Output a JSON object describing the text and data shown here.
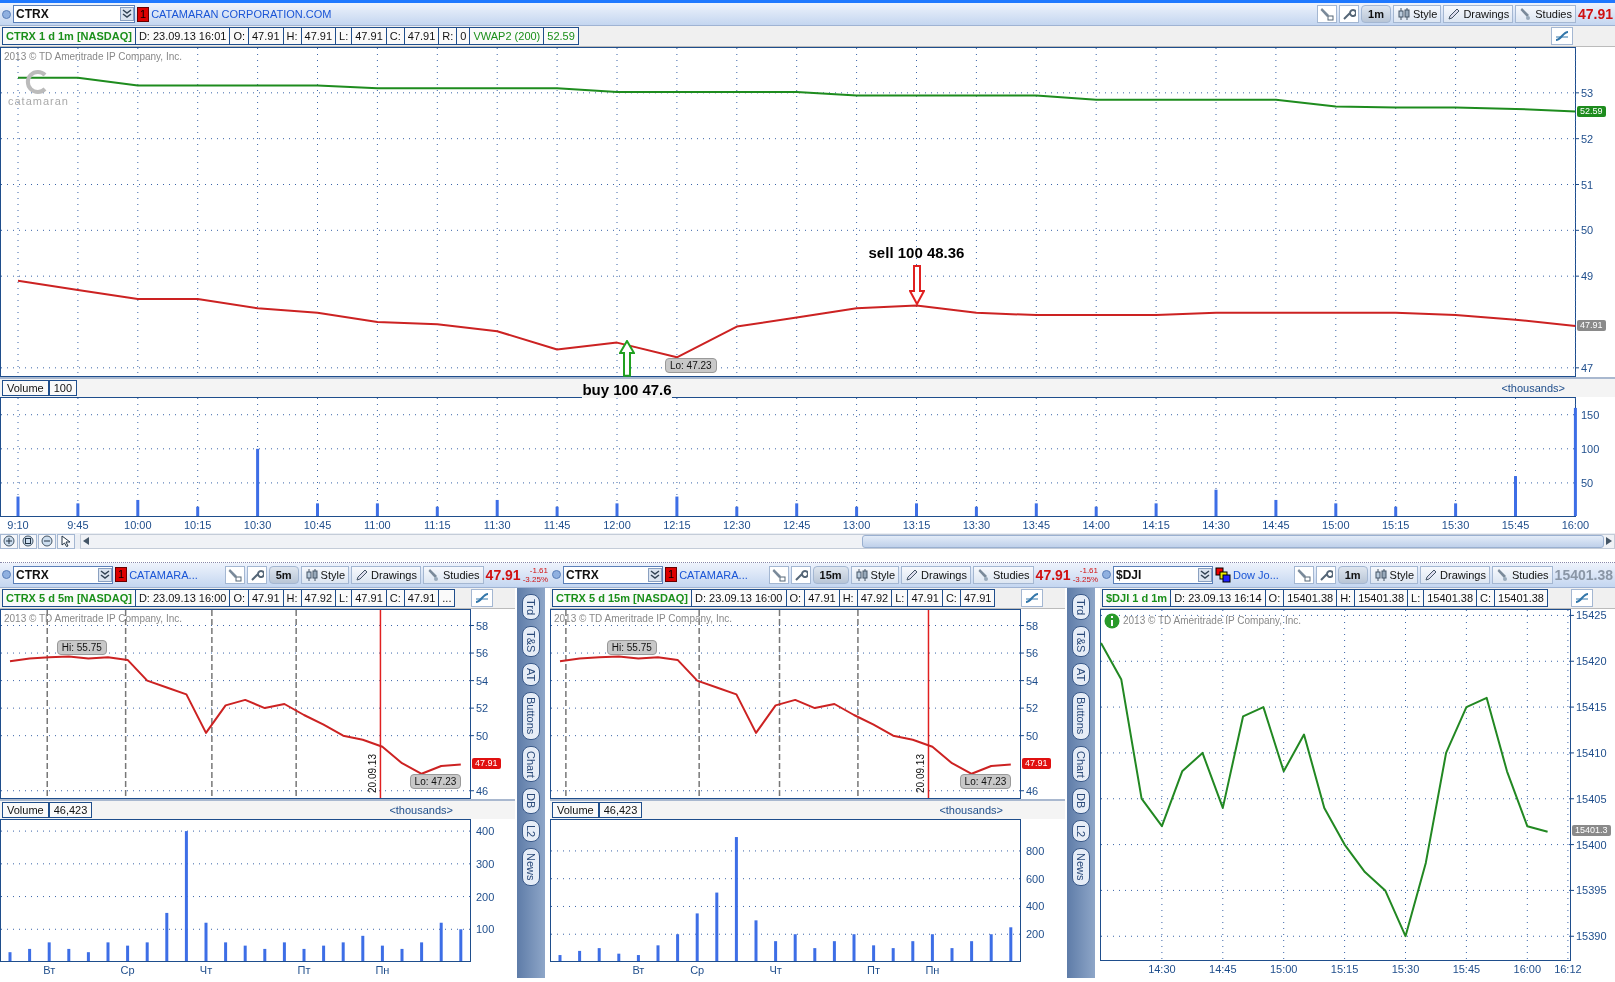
{
  "main": {
    "header": {
      "symbol": "CTRX",
      "badge": {
        "kind": "alert",
        "text": "1"
      },
      "company": "CATAMARAN CORPORATION.COM",
      "interval": "1m",
      "buttons": [
        {
          "kind": "style",
          "label": "Style"
        },
        {
          "kind": "drawings",
          "label": "Drawings"
        },
        {
          "kind": "studies",
          "label": "Studies"
        }
      ],
      "last": "47.91",
      "falling": true
    },
    "info": [
      {
        "kind": "title",
        "text": "CTRX 1 d 1m [NASDAQ]"
      },
      {
        "kind": "cell",
        "text": "D: 23.09.13 16:01"
      },
      {
        "kind": "cell",
        "text": "O:"
      },
      {
        "kind": "cell",
        "text": "47.91"
      },
      {
        "kind": "cell",
        "text": "H:"
      },
      {
        "kind": "cell",
        "text": "47.91"
      },
      {
        "kind": "cell",
        "text": "L:"
      },
      {
        "kind": "cell",
        "text": "47.91"
      },
      {
        "kind": "cell",
        "text": "C:"
      },
      {
        "kind": "cell",
        "text": "47.91"
      },
      {
        "kind": "cell",
        "text": "R:"
      },
      {
        "kind": "cell",
        "text": "0"
      },
      {
        "kind": "study",
        "text": "VWAP2 (200)"
      },
      {
        "kind": "study",
        "text": "52.59"
      }
    ],
    "watermark": "2013 © TD Ameritrade IP Company, Inc.",
    "logo": "catamaran",
    "price": {
      "chart_data": {
        "type": "line",
        "ylim": [
          46.8,
          54
        ],
        "yticks": [
          47,
          49,
          50,
          51,
          52,
          53
        ],
        "grid": true,
        "series": [
          {
            "color": "#1e8c1e",
            "values": [
              53.33,
              53.33,
              53.16,
              53.16,
              53.16,
              53.16,
              53.1,
              53.1,
              53.1,
              53.1,
              53.02,
              53.02,
              53.02,
              53.02,
              52.94,
              52.94,
              52.94,
              52.94,
              52.85,
              52.85,
              52.85,
              52.85,
              52.7,
              52.68,
              52.68,
              52.65,
              52.59
            ]
          },
          {
            "color": "#cc2222",
            "values": [
              48.9,
              48.7,
              48.5,
              48.5,
              48.3,
              48.2,
              48.0,
              47.95,
              47.8,
              47.4,
              47.55,
              47.23,
              47.9,
              48.1,
              48.3,
              48.36,
              48.2,
              48.15,
              48.15,
              48.15,
              48.2,
              48.2,
              48.2,
              48.2,
              48.15,
              48.05,
              47.91
            ]
          }
        ],
        "annotations": [
          {
            "text": "sell 100 48.36",
            "y": 48.36
          },
          {
            "text": "buy 100 47.6",
            "y": 47.6
          },
          "Lo: 47.23"
        ]
      },
      "markers": [
        {
          "kind": "sell"
        },
        {
          "kind": "buy"
        },
        {
          "kind": "low"
        }
      ],
      "tags": [
        {
          "text": "52.59",
          "color": "#1e8c1e"
        },
        {
          "text": "47.91",
          "color": "#8a8a8a"
        }
      ]
    },
    "volume": {
      "label": "Volume",
      "value": "100",
      "units": "<thousands>",
      "chart_data": {
        "type": "bar",
        "categories": [
          "9:10",
          "9:45",
          "10:00",
          "10:15",
          "10:30",
          "10:45",
          "11:00",
          "11:15",
          "11:30",
          "11:45",
          "12:00",
          "12:15",
          "12:30",
          "12:45",
          "13:00",
          "13:15",
          "13:30",
          "13:45",
          "14:00",
          "14:15",
          "14:30",
          "14:45",
          "15:00",
          "15:15",
          "15:30",
          "15:45",
          "16:00"
        ],
        "ylim": [
          0,
          176
        ],
        "yticks": [
          50,
          100,
          150
        ],
        "grid": true,
        "values": [
          30,
          20,
          25,
          15,
          100,
          20,
          20,
          15,
          25,
          15,
          20,
          30,
          15,
          20,
          15,
          20,
          15,
          20,
          15,
          20,
          40,
          25,
          20,
          15,
          20,
          60,
          160
        ]
      }
    }
  },
  "panels": [
    {
      "header": {
        "symbol": "CTRX",
        "badge": {
          "kind": "alert",
          "text": "1"
        },
        "company": "CATAMARA...",
        "interval": "5m",
        "buttons": [
          {
            "kind": "style",
            "label": "Style"
          },
          {
            "kind": "drawings",
            "label": "Drawings"
          },
          {
            "kind": "studies",
            "label": "Studies"
          }
        ],
        "last": "47.91",
        "falling": true,
        "change": [
          "-1.61",
          "-3.25%"
        ]
      },
      "info": [
        {
          "kind": "title",
          "text": "CTRX 5 d 5m [NASDAQ]"
        },
        {
          "kind": "cell",
          "text": "D: 23.09.13 16:00"
        },
        {
          "kind": "cell",
          "text": "O:"
        },
        {
          "kind": "cell",
          "text": "47.91"
        },
        {
          "kind": "cell",
          "text": "H:"
        },
        {
          "kind": "cell",
          "text": "47.92"
        },
        {
          "kind": "cell",
          "text": "L:"
        },
        {
          "kind": "cell",
          "text": "47.91"
        },
        {
          "kind": "cell",
          "text": "C:"
        },
        {
          "kind": "cell",
          "text": "47.91"
        },
        {
          "kind": "cell",
          "text": "..."
        }
      ],
      "watermark": "2013 © TD Ameritrade IP Company, Inc.",
      "price": {
        "chart_data": {
          "type": "line",
          "ylim": [
            45.4,
            59.2
          ],
          "yticks": [
            46,
            50,
            52,
            54,
            56,
            58
          ],
          "grid": true,
          "series": [
            {
              "color": "#cc2222",
              "values": [
                55.4,
                55.6,
                55.7,
                55.75,
                55.6,
                55.7,
                55.5,
                54.0,
                53.5,
                53.0,
                50.2,
                52.2,
                52.6,
                52.0,
                52.3,
                51.5,
                50.8,
                50.0,
                49.7,
                49.2,
                48.0,
                47.23,
                47.8,
                47.91
              ]
            }
          ],
          "annotations": [
            "Hi: 55.75",
            "Lo: 47.23",
            "20.09.13"
          ]
        },
        "markers": [
          {
            "kind": "high"
          },
          {
            "kind": "low"
          },
          {
            "kind": "session"
          }
        ],
        "tags": [
          {
            "text": "47.91",
            "color": "#e01010"
          }
        ]
      },
      "volume": {
        "label": "Volume",
        "value": "46,423",
        "units": "<thousands>",
        "chart_data": {
          "type": "bar",
          "categories": [
            null,
            null,
            "Вт",
            null,
            null,
            null,
            "Ср",
            null,
            null,
            null,
            "Чт",
            null,
            null,
            null,
            null,
            "Пт",
            null,
            null,
            null,
            "Пн",
            null,
            null,
            null,
            null
          ],
          "ylim": [
            0,
            437
          ],
          "yticks": [
            100,
            200,
            300,
            400
          ],
          "grid": true,
          "values": [
            30,
            40,
            60,
            40,
            30,
            60,
            50,
            60,
            150,
            400,
            120,
            60,
            50,
            40,
            60,
            40,
            50,
            60,
            80,
            50,
            40,
            60,
            120,
            100
          ]
        }
      },
      "side_tabs": [
        "Trd",
        "T&S",
        "AT",
        "Buttons",
        "Chart",
        "DB",
        "L2",
        "News"
      ]
    },
    {
      "header": {
        "symbol": "CTRX",
        "badge": {
          "kind": "alert",
          "text": "1"
        },
        "company": "CATAMARA...",
        "interval": "15m",
        "buttons": [
          {
            "kind": "style",
            "label": "Style"
          },
          {
            "kind": "drawings",
            "label": "Drawings"
          },
          {
            "kind": "studies",
            "label": "Studies"
          }
        ],
        "last": "47.91",
        "falling": true,
        "change": [
          "-1.61",
          "-3.25%"
        ]
      },
      "info": [
        {
          "kind": "title",
          "text": "CTRX 5 d 15m [NASDAQ]"
        },
        {
          "kind": "cell",
          "text": "D: 23.09.13 16:00"
        },
        {
          "kind": "cell",
          "text": "O:"
        },
        {
          "kind": "cell",
          "text": "47.91"
        },
        {
          "kind": "cell",
          "text": "H:"
        },
        {
          "kind": "cell",
          "text": "47.92"
        },
        {
          "kind": "cell",
          "text": "L:"
        },
        {
          "kind": "cell",
          "text": "47.91"
        },
        {
          "kind": "cell",
          "text": "C:"
        },
        {
          "kind": "cell",
          "text": "47.91"
        }
      ],
      "watermark": "2013 © TD Ameritrade IP Company, Inc.",
      "price": {
        "chart_data": {
          "type": "line",
          "ylim": [
            45.4,
            59.2
          ],
          "yticks": [
            46,
            50,
            52,
            54,
            56,
            58
          ],
          "grid": true,
          "series": [
            {
              "color": "#cc2222",
              "values": [
                55.4,
                55.6,
                55.7,
                55.75,
                55.6,
                55.7,
                55.5,
                54.0,
                53.5,
                53.0,
                50.2,
                52.2,
                52.6,
                52.0,
                52.3,
                51.5,
                50.8,
                50.0,
                49.7,
                49.2,
                48.0,
                47.23,
                47.8,
                47.91
              ]
            }
          ],
          "annotations": [
            "Hi: 55.75",
            "Lo: 47.23",
            "20.09.13"
          ]
        },
        "markers": [
          {
            "kind": "high"
          },
          {
            "kind": "low"
          },
          {
            "kind": "session"
          }
        ],
        "tags": [
          {
            "text": "47.91",
            "color": "#e01010"
          }
        ]
      },
      "volume": {
        "label": "Volume",
        "value": "46,423",
        "units": "<thousands>",
        "chart_data": {
          "type": "bar",
          "categories": [
            null,
            null,
            null,
            null,
            "Вт",
            null,
            null,
            "Ср",
            null,
            null,
            null,
            "Чт",
            null,
            null,
            null,
            null,
            "Пт",
            null,
            null,
            "Пн",
            null,
            null,
            null,
            null
          ],
          "ylim": [
            0,
            1030
          ],
          "yticks": [
            200,
            400,
            600,
            800
          ],
          "grid": true,
          "values": [
            50,
            80,
            100,
            60,
            50,
            120,
            200,
            350,
            500,
            900,
            300,
            150,
            200,
            100,
            150,
            200,
            120,
            100,
            150,
            200,
            100,
            150,
            200,
            250
          ]
        }
      },
      "side_tabs": [
        "Trd",
        "T&S",
        "AT",
        "Buttons",
        "Chart",
        "DB",
        "L2",
        "News"
      ]
    },
    {
      "header": {
        "symbol": "$DJI",
        "badge": {
          "kind": "link"
        },
        "company": "Dow Jo...",
        "interval": "1m",
        "buttons": [
          {
            "kind": "style",
            "label": "Style"
          },
          {
            "kind": "drawings",
            "label": "Drawings"
          },
          {
            "kind": "studies",
            "label": "Studies"
          }
        ],
        "last": "15401.38",
        "falling": false
      },
      "info": [
        {
          "kind": "title",
          "text": "$DJI 1 d 1m"
        },
        {
          "kind": "cell",
          "text": "D: 23.09.13 16:14"
        },
        {
          "kind": "cell",
          "text": "O:"
        },
        {
          "kind": "cell",
          "text": "15401.38"
        },
        {
          "kind": "cell",
          "text": "H:"
        },
        {
          "kind": "cell",
          "text": "15401.38"
        },
        {
          "kind": "cell",
          "text": "L:"
        },
        {
          "kind": "cell",
          "text": "15401.38"
        },
        {
          "kind": "cell",
          "text": "C:"
        },
        {
          "kind": "cell",
          "text": "15401.38"
        }
      ],
      "watermark": "2013 © TD Ameritrade IP Company, Inc.",
      "notice": true,
      "price": {
        "chart_data": {
          "type": "line",
          "categories": [
            null,
            null,
            null,
            "14:30",
            null,
            null,
            "14:45",
            null,
            null,
            "15:00",
            null,
            null,
            "15:15",
            null,
            null,
            "15:30",
            null,
            null,
            "15:45",
            null,
            null,
            "16:00",
            null,
            "16:12"
          ],
          "ylim": [
            15387.3,
            15425.7
          ],
          "yticks": [
            15390,
            15395,
            15400,
            15405,
            15410,
            15415,
            15420,
            15425
          ],
          "grid": true,
          "series": [
            {
              "color": "#228822",
              "values": [
                15422,
                15418,
                15405,
                15402,
                15408,
                15410,
                15404,
                15414,
                15415,
                15408,
                15412,
                15404,
                15400,
                15397,
                15395,
                15390,
                15398,
                15410,
                15415,
                15416,
                15408,
                15402,
                15401.4,
                null
              ]
            }
          ]
        },
        "tags": [
          {
            "text": "15401.3",
            "color": "#8a8a8a"
          }
        ]
      }
    }
  ]
}
